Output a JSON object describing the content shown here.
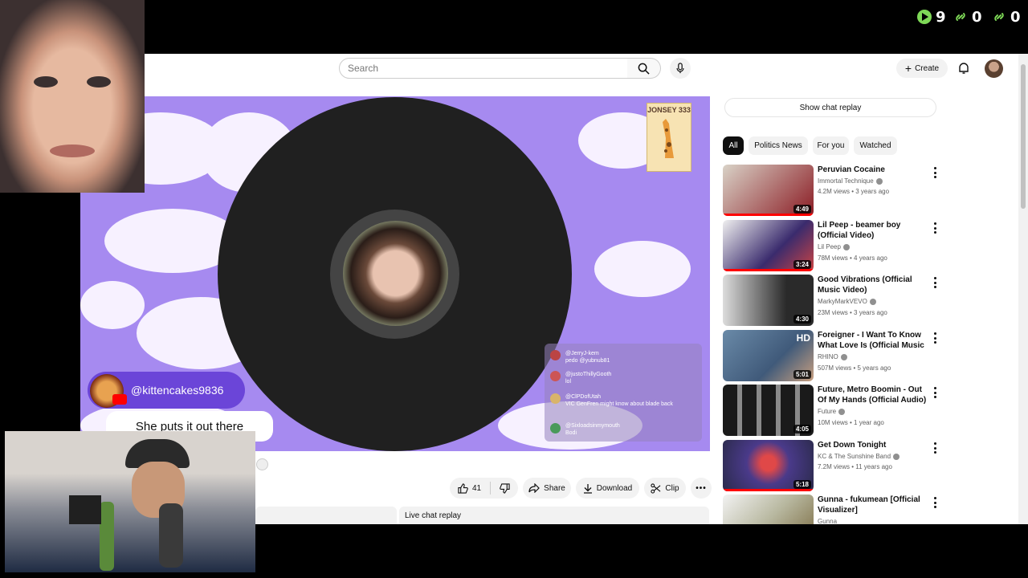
{
  "counters": [
    {
      "icon": "play-icon",
      "value": "9",
      "color": "#7ed957"
    },
    {
      "icon": "link-icon",
      "value": "0",
      "color": "#7ed957"
    },
    {
      "icon": "link-icon",
      "value": "0",
      "color": "#7ed957"
    }
  ],
  "header": {
    "search_placeholder": "Search",
    "create_label": "Create"
  },
  "player": {
    "badge_text": "JONSEY 333",
    "commenter": "@kittencakes9836",
    "comment_text": "She puts it out there",
    "chat_overlay": [
      {
        "user": "@JerryJ-kem",
        "msg": "pedo @yubnub81"
      },
      {
        "user": "@justoThillyGooth",
        "msg": "lol"
      },
      {
        "user": "@ClPDofUtah",
        "msg": "VIC GenFren might know about blade back"
      },
      {
        "user": "@Sixloadsinmymouth",
        "msg": "Bodi"
      }
    ]
  },
  "actions": {
    "like_count": "41",
    "share_label": "Share",
    "download_label": "Download",
    "clip_label": "Clip"
  },
  "live_chat_replay_label": "Live chat replay",
  "sidebar": {
    "show_chat_label": "Show chat replay",
    "chips": [
      "All",
      "Politics News",
      "For you",
      "Watched"
    ],
    "videos": [
      {
        "title": "Peruvian Cocaine",
        "channel": "Immortal Technique",
        "meta": "4.2M views • 3 years ago",
        "duration": "4:49",
        "thumb_color": "#8b1c24"
      },
      {
        "title": "Lil Peep - beamer boy (Official Video)",
        "channel": "Lil Peep",
        "meta": "78M views • 4 years ago",
        "duration": "3:24",
        "thumb_color": "#3a2b6d"
      },
      {
        "title": "Good Vibrations (Official Music Video)",
        "channel": "MarkyMarkVEVO",
        "meta": "23M views • 3 years ago",
        "duration": "4:30",
        "thumb_color": "#2a2a2a"
      },
      {
        "title": "Foreigner - I Want To Know What Love Is (Official Music ...",
        "channel": "RHINO",
        "meta": "507M views • 5 years ago",
        "duration": "5:01",
        "thumb_color": "#405a7a"
      },
      {
        "title": "Future, Metro Boomin - Out Of My Hands (Official Audio)",
        "channel": "Future",
        "meta": "10M views • 1 year ago",
        "duration": "4:05",
        "thumb_color": "#1a1a1a"
      },
      {
        "title": "Get Down Tonight",
        "channel": "KC & The Sunshine Band",
        "meta": "7.2M views • 11 years ago",
        "duration": "5:18",
        "thumb_color": "#4a3a8a"
      },
      {
        "title": "Gunna - fukumean [Official Visualizer]",
        "channel": "Gunna",
        "meta": "",
        "duration": "",
        "thumb_color": "#b8b8a0"
      }
    ]
  }
}
